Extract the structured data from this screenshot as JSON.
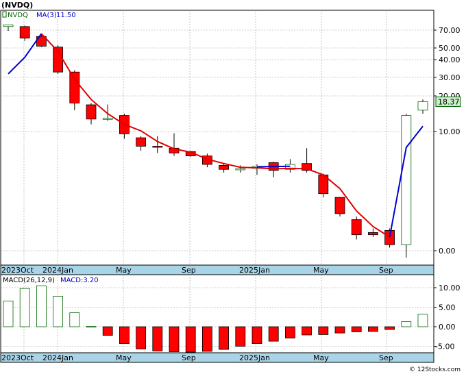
{
  "header": {
    "symbol": "(NVDQ)",
    "watermark": "© 12Stocks.com"
  },
  "colors": {
    "up": "#ffffff",
    "up_stroke": "#006400",
    "down": "#ff0000",
    "down_stroke": "#8b0000",
    "ma_blue": "#0000cc",
    "ma_red": "#e00000",
    "axis_band": "#a9d3e6",
    "grid": "#999999",
    "last_box": "#c8f0c8"
  },
  "chart_data": [
    {
      "type": "candlestick",
      "title": "NVDQ",
      "legend": {
        "symbol": "NVDQ",
        "ma_label": "MA(3)",
        "ma_value": "11.50"
      },
      "last_price": "18.37",
      "scale": "log-like",
      "yticks": [
        {
          "label": "70.00",
          "value": 70
        },
        {
          "label": "50.00",
          "value": 50
        },
        {
          "label": "40.00",
          "value": 40
        },
        {
          "label": "30.00",
          "value": 30
        },
        {
          "label": "20.00",
          "value": 20
        },
        {
          "label": "10.00",
          "value": 10
        },
        {
          "label": "0.00",
          "value": 0
        }
      ],
      "xlabels": [
        "2023Oct",
        "2024Jan",
        "May",
        "Sep",
        "2025Jan",
        "May",
        "Sep"
      ],
      "candles": [
        {
          "o": 74,
          "h": 76,
          "l": 69,
          "c": 76
        },
        {
          "o": 74,
          "h": 75,
          "l": 58,
          "c": 61
        },
        {
          "o": 63,
          "h": 66,
          "l": 51,
          "c": 52
        },
        {
          "o": 51,
          "h": 53,
          "l": 32,
          "c": 33
        },
        {
          "o": 33,
          "h": 34,
          "l": 16,
          "c": 18
        },
        {
          "o": 17.5,
          "h": 18,
          "l": 12,
          "c": 13.5
        },
        {
          "o": 13.5,
          "h": 17.6,
          "l": 13,
          "c": 13.7
        },
        {
          "o": 14.5,
          "h": 15,
          "l": 8.5,
          "c": 9.5
        },
        {
          "o": 8.7,
          "h": 9.0,
          "l": 6.5,
          "c": 7.2
        },
        {
          "o": 7.2,
          "h": 9.0,
          "l": 6.2,
          "c": 7.1
        },
        {
          "o": 6.9,
          "h": 9.6,
          "l": 5.8,
          "c": 6.2
        },
        {
          "o": 6.4,
          "h": 6.5,
          "l": 5.7,
          "c": 5.8
        },
        {
          "o": 5.8,
          "h": 6.1,
          "l": 4.5,
          "c": 4.8
        },
        {
          "o": 4.7,
          "h": 4.9,
          "l": 4.0,
          "c": 4.3
        },
        {
          "o": 4.3,
          "h": 4.7,
          "l": 4.0,
          "c": 4.35
        },
        {
          "o": 4.4,
          "h": 4.8,
          "l": 3.8,
          "c": 4.6
        },
        {
          "o": 5.0,
          "h": 5.1,
          "l": 3.6,
          "c": 4.2
        },
        {
          "o": 4.3,
          "h": 5.4,
          "l": 4.0,
          "c": 4.8
        },
        {
          "o": 4.9,
          "h": 6.9,
          "l": 4.0,
          "c": 4.2
        },
        {
          "o": 3.8,
          "h": 3.9,
          "l": 2.3,
          "c": 2.5
        },
        {
          "o": 2.3,
          "h": 2.3,
          "l": 1.5,
          "c": 1.6
        },
        {
          "o": 1.4,
          "h": 1.5,
          "l": 0.9,
          "c": 1.0
        },
        {
          "o": 1.05,
          "h": 1.15,
          "l": 0.95,
          "c": 1.0
        },
        {
          "o": 1.1,
          "h": 1.15,
          "l": 0.75,
          "c": 0.8
        },
        {
          "o": 0.8,
          "h": 15,
          "l": 0.5,
          "c": 14.5
        },
        {
          "o": 16,
          "h": 19,
          "l": 15,
          "c": 18.37
        }
      ],
      "ma_blue_points": [
        [
          0,
          32
        ],
        [
          1,
          42
        ],
        [
          2,
          66
        ],
        [
          15,
          4.55
        ],
        [
          17,
          4.6
        ],
        [
          23,
          0.95
        ],
        [
          24,
          7.0
        ],
        [
          25,
          11.5
        ]
      ],
      "ma_red_points": [
        [
          2,
          66
        ],
        [
          3,
          47
        ],
        [
          4,
          29
        ],
        [
          5,
          19
        ],
        [
          6,
          15
        ],
        [
          7,
          12
        ],
        [
          8,
          10.2
        ],
        [
          9,
          8
        ],
        [
          10,
          6.8
        ],
        [
          11,
          6.3
        ],
        [
          12,
          5.4
        ],
        [
          13,
          4.9
        ],
        [
          14,
          4.5
        ],
        [
          15,
          4.45
        ],
        [
          16,
          4.35
        ],
        [
          17,
          4.4
        ],
        [
          18,
          4.35
        ],
        [
          19,
          3.8
        ],
        [
          20,
          2.8
        ],
        [
          21,
          1.7
        ],
        [
          22,
          1.2
        ],
        [
          23,
          0.95
        ]
      ]
    },
    {
      "type": "bar",
      "title": "MACD",
      "legend": {
        "label": "MACD(26,12,9)",
        "value_label": "MACD:3.20"
      },
      "yticks": [
        {
          "label": "10.00",
          "value": 10
        },
        {
          "label": "5.00",
          "value": 5
        },
        {
          "label": "0.00",
          "value": 0
        },
        {
          "label": "-5.00",
          "value": -5
        }
      ],
      "xlabels": [
        "2023Oct",
        "2024Jan",
        "May",
        "Sep",
        "2025Jan",
        "May",
        "Sep"
      ],
      "values": [
        6.6,
        9.8,
        10.5,
        7.8,
        3.6,
        0.1,
        -2.2,
        -4.3,
        -5.7,
        -6.2,
        -6.4,
        -6.5,
        -6.3,
        -5.8,
        -5.0,
        -4.3,
        -3.7,
        -2.9,
        -2.1,
        -2.0,
        -1.6,
        -1.3,
        -1.2,
        -0.7,
        1.3,
        3.2
      ]
    }
  ]
}
